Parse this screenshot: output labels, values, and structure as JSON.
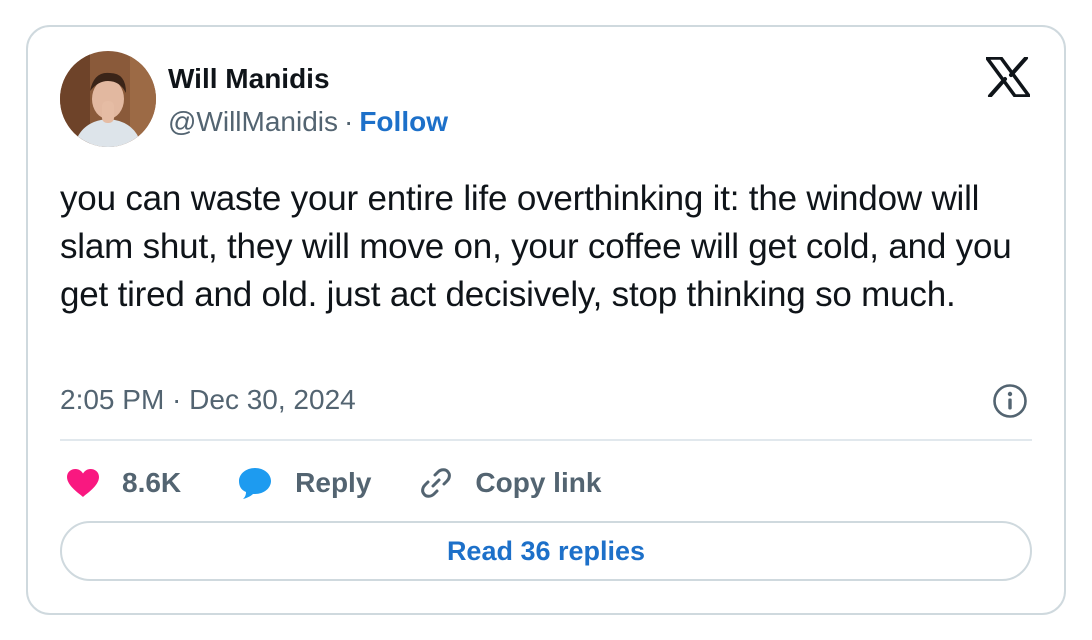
{
  "author": {
    "display_name": "Will Manidis",
    "handle": "@WillManidis",
    "separator": "·",
    "follow_label": "Follow",
    "avatar_icon": "profile-photo"
  },
  "brand": {
    "logo_icon": "x-logo-icon"
  },
  "tweet": {
    "text": "you can waste your entire life overthinking it: the window will slam shut, they will move on, your coffee will get cold, and you get tired and old. just act decisively, stop thinking so much.",
    "timestamp": "2:05 PM · Dec 30, 2024"
  },
  "actions": {
    "like": {
      "icon": "heart-icon",
      "count": "8.6K"
    },
    "reply": {
      "icon": "speech-bubble-icon",
      "label": "Reply"
    },
    "copy_link": {
      "icon": "link-icon",
      "label": "Copy link"
    },
    "info_icon": "info-icon"
  },
  "read_replies_label": "Read 36 replies",
  "colors": {
    "accent": "#1d70c9",
    "heart": "#f91880",
    "reply_bubble": "#1d9bf0",
    "text": "#0f1419",
    "muted": "#536471",
    "border": "#cfd9de"
  }
}
